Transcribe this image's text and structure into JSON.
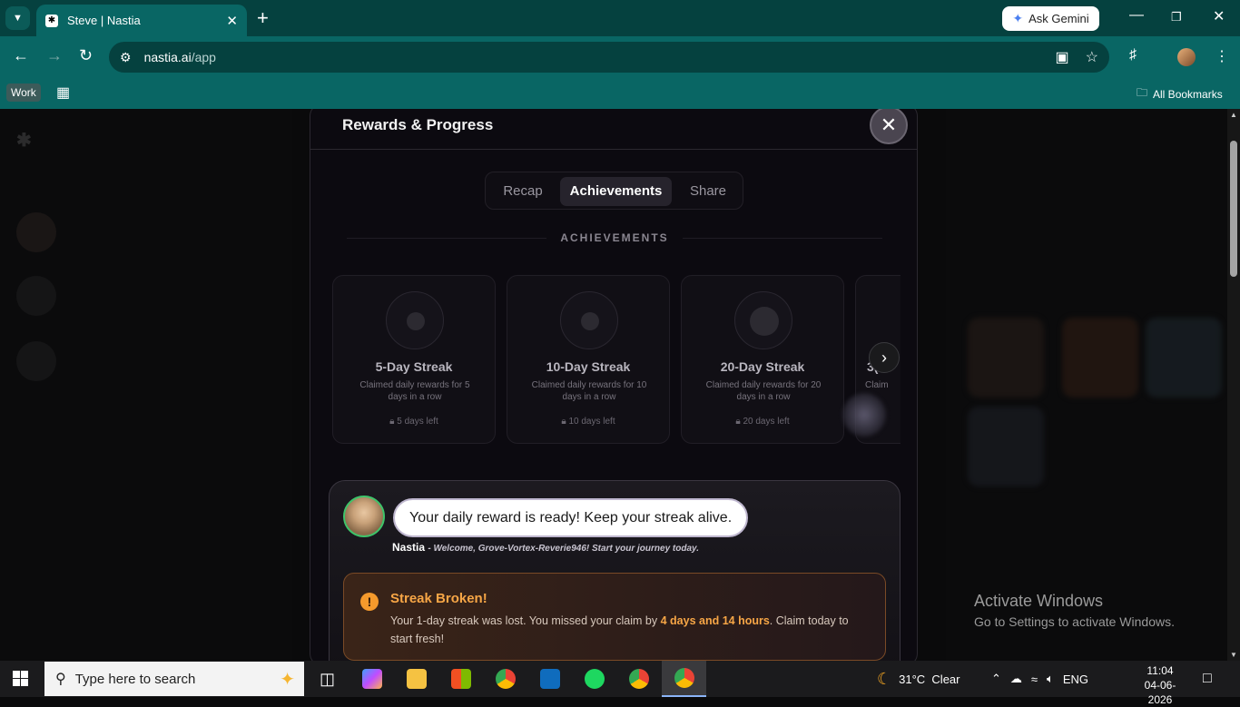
{
  "browser": {
    "tab_title": "Steve | Nastia",
    "url_host": "nastia.ai",
    "url_path": "/app",
    "ask_gemini": "Ask Gemini",
    "bookmark_work": "Work",
    "all_bookmarks": "All Bookmarks"
  },
  "modal": {
    "title": "Rewards & Progress",
    "tabs": [
      "Recap",
      "Achievements",
      "Share"
    ],
    "active_tab": "Achievements",
    "section_label": "ACHIEVEMENTS",
    "achievements": [
      {
        "title": "5-Day Streak",
        "desc": "Claimed daily rewards for 5 days in a row",
        "left": "5 days left"
      },
      {
        "title": "10-Day Streak",
        "desc": "Claimed daily rewards for 10 days in a row",
        "left": "10 days left"
      },
      {
        "title": "20-Day Streak",
        "desc": "Claimed daily rewards for 20 days in a row",
        "left": "20 days left"
      },
      {
        "title": "3(",
        "desc": "Claim",
        "left": ""
      }
    ],
    "chat": {
      "message": "Your daily reward is ready! Keep your streak alive.",
      "sender": "Nastia",
      "subtitle": "- Welcome, Grove-Vortex-Reverie946! Start your journey today."
    },
    "alert": {
      "title": "Streak Broken!",
      "body_1": "Your 1-day streak was lost. You missed your claim by ",
      "body_bold": "4 days and 14 hours",
      "body_2": ". Claim today to start fresh!"
    }
  },
  "windows": {
    "activate_title": "Activate Windows",
    "activate_sub": "Go to Settings to activate Windows."
  },
  "taskbar": {
    "search_placeholder": "Type here to search",
    "weather": "31°C  Clear",
    "lang": "ENG",
    "time": "11:04",
    "date": "04-06-2026"
  }
}
